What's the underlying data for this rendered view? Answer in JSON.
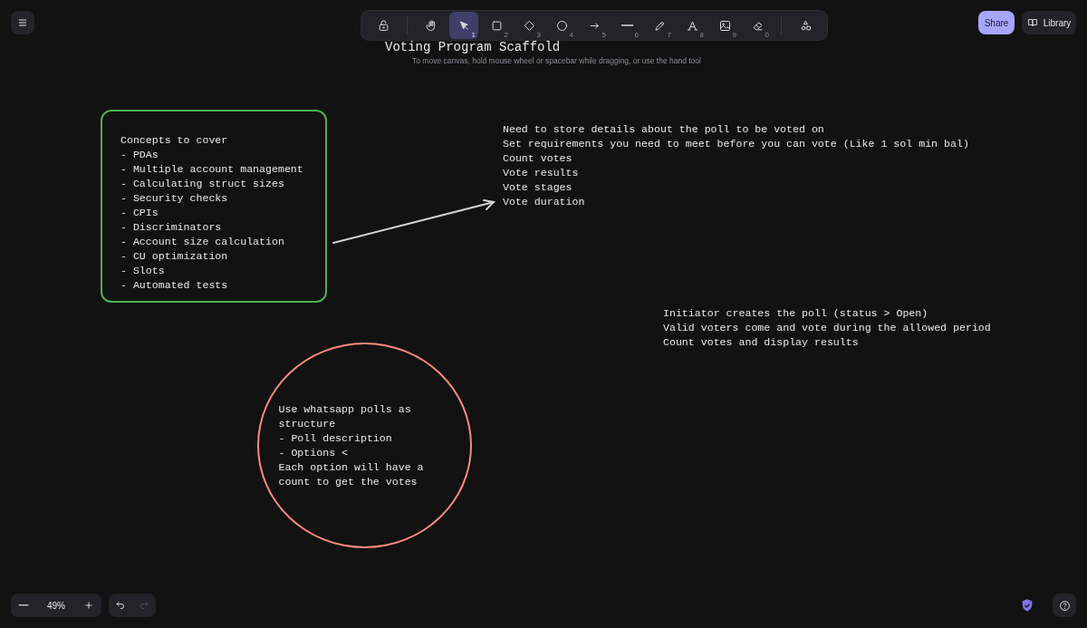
{
  "toolbar": {
    "tools": [
      {
        "kind": "lock",
        "selected": false
      },
      {
        "kind": "hand",
        "selected": false
      },
      {
        "kind": "pointer",
        "key": "1",
        "selected": true
      },
      {
        "kind": "rectangle",
        "key": "2",
        "selected": false
      },
      {
        "kind": "diamond",
        "key": "3",
        "selected": false
      },
      {
        "kind": "ellipse",
        "key": "4",
        "selected": false
      },
      {
        "kind": "arrow",
        "key": "5",
        "selected": false
      },
      {
        "kind": "line",
        "key": "6",
        "selected": false
      },
      {
        "kind": "pencil",
        "key": "7",
        "selected": false
      },
      {
        "kind": "text",
        "key": "8",
        "selected": false
      },
      {
        "kind": "image",
        "key": "9",
        "selected": false
      },
      {
        "kind": "eraser",
        "key": "0",
        "selected": false
      },
      {
        "kind": "shapes",
        "selected": false
      }
    ]
  },
  "share_button": "Share",
  "library_button": "Library",
  "canvas": {
    "title": "Voting Program Scaffold",
    "hint": "To move canvas, hold mouse wheel or spacebar while dragging, or use the hand tool",
    "elements": [
      {
        "kind": "box",
        "color": "#4caf50",
        "lines": [
          "Concepts to cover",
          "- PDAs",
          "- Multiple account management",
          "- Calculating struct sizes",
          "- Security checks",
          "- CPIs",
          "- Discriminators",
          "- Account size calculation",
          "- CU optimization",
          "- Slots",
          "- Automated tests"
        ]
      },
      {
        "kind": "arrow"
      },
      {
        "kind": "text",
        "lines": [
          "Need to store details about the poll to be voted on",
          "Set requirements you need to meet before you can vote (Like 1 sol min bal)",
          "Count votes",
          "Vote results",
          "Vote stages",
          "Vote duration"
        ]
      },
      {
        "kind": "text",
        "lines": [
          "Initiator creates the poll (status > Open)",
          "Valid voters come and vote during the allowed period",
          "Count votes and display results"
        ]
      },
      {
        "kind": "circle",
        "color": "#ff8a80",
        "lines": [
          "Use whatsapp polls as",
          "structure",
          "- Poll description",
          "- Options <",
          "Each option will have a",
          "count to get the votes"
        ]
      }
    ]
  },
  "zoom": {
    "level_text": "49%"
  },
  "history": {
    "undo_disabled": false,
    "redo_disabled": true
  }
}
